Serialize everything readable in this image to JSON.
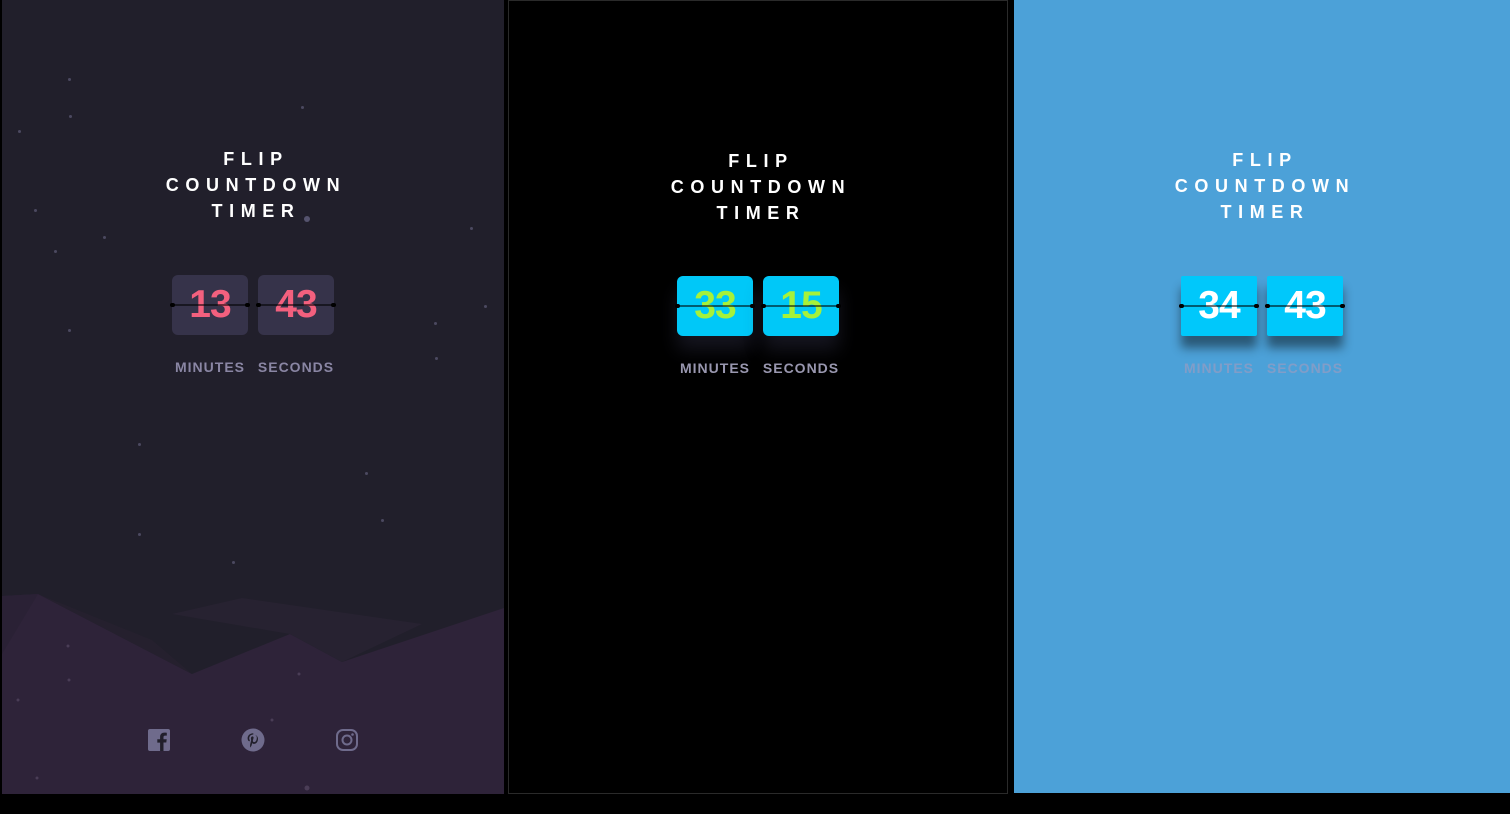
{
  "panels": [
    {
      "theme": {
        "background": "#211f2b",
        "card": "#36334a",
        "digits": "#f3607e",
        "label": "#8a86a4"
      },
      "title": [
        "FLIP",
        "COUNTDOWN",
        "TIMER"
      ],
      "minutes": "13",
      "seconds": "43",
      "minutes_label": "MINUTES",
      "seconds_label": "SECONDS",
      "social": [
        "facebook-icon",
        "pinterest-icon",
        "instagram-icon"
      ]
    },
    {
      "theme": {
        "background": "#000000",
        "card": "#00c8f8",
        "digits": "#a6f13a",
        "label": "#9a98b0"
      },
      "title": [
        "FLIP",
        "COUNTDOWN",
        "TIMER"
      ],
      "minutes": "33",
      "seconds": "15",
      "minutes_label": "MINUTES",
      "seconds_label": "SECONDS"
    },
    {
      "theme": {
        "background": "#4ca1d8",
        "card": "#00c8fb",
        "digits": "#ffffff",
        "label": "#c29ab6"
      },
      "title": [
        "FLIP",
        "COUNTDOWN",
        "TIMER"
      ],
      "minutes": "34",
      "seconds": "43",
      "minutes_label": "MINUTES",
      "seconds_label": "SECONDS"
    }
  ]
}
